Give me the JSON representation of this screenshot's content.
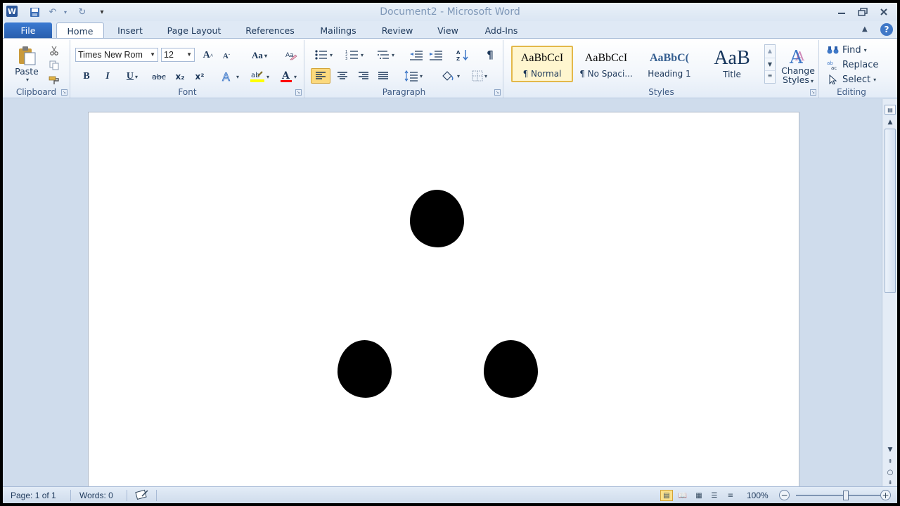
{
  "title_bar": {
    "app_icon": "W",
    "title": "Document2  -  Microsoft Word"
  },
  "tabs": [
    {
      "label": "File"
    },
    {
      "label": "Home"
    },
    {
      "label": "Insert"
    },
    {
      "label": "Page Layout"
    },
    {
      "label": "References"
    },
    {
      "label": "Mailings"
    },
    {
      "label": "Review"
    },
    {
      "label": "View"
    },
    {
      "label": "Add-Ins"
    }
  ],
  "clipboard": {
    "paste_label": "Paste",
    "group_label": "Clipboard"
  },
  "font": {
    "font_name": "Times New Rom",
    "font_size": "12",
    "change_case": "Aa",
    "bold": "B",
    "italic": "I",
    "underline": "U",
    "strikethrough": "abc",
    "subscript": "x₂",
    "superscript": "x²",
    "group_label": "Font"
  },
  "paragraph": {
    "show_marks": "¶",
    "group_label": "Paragraph"
  },
  "styles": {
    "items": [
      {
        "sample": "AaBbCcI",
        "name": "¶ Normal"
      },
      {
        "sample": "AaBbCcI",
        "name": "¶ No Spaci..."
      },
      {
        "sample": "AaBbC(",
        "name": "Heading 1"
      },
      {
        "sample": "AaB",
        "name": "Title"
      }
    ],
    "change_styles_line1": "Change",
    "change_styles_line2": "Styles",
    "group_label": "Styles"
  },
  "editing": {
    "find": "Find",
    "replace": "Replace",
    "select": "Select",
    "group_label": "Editing"
  },
  "status_bar": {
    "page": "Page: 1 of 1",
    "words": "Words: 0",
    "zoom": "100%",
    "zoom_level": 1.0
  },
  "colors": {
    "file_tab": "#2a5fad",
    "highlight": "#ffff00",
    "font_color": "#ff0000",
    "selected_style_border": "#e3b84a"
  }
}
